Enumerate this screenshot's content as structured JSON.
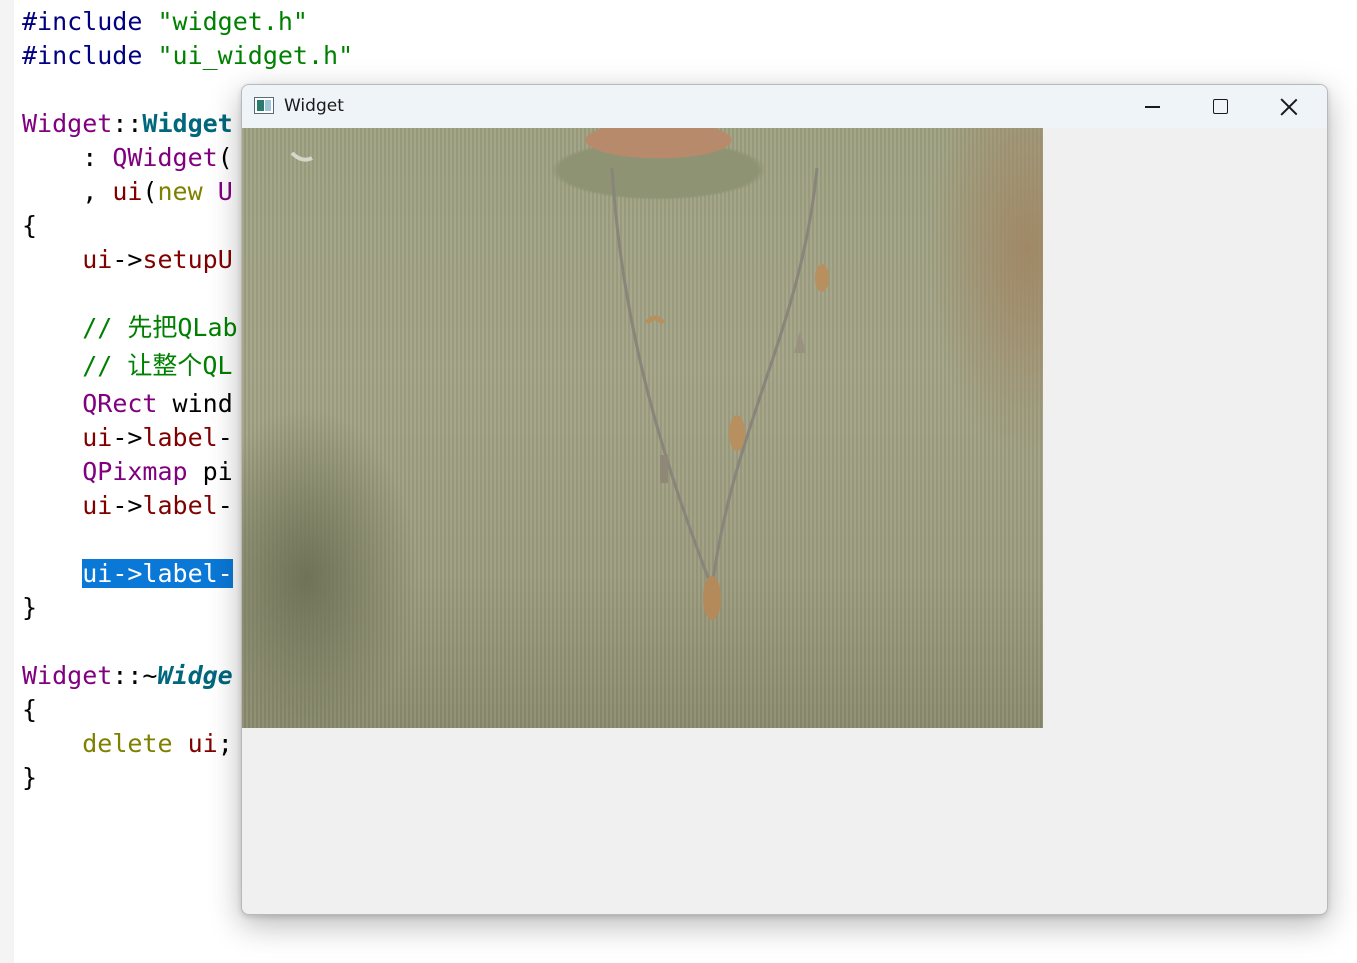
{
  "editor": {
    "lines": [
      {
        "segments": [
          {
            "t": "#include ",
            "c": "k-directive"
          },
          {
            "t": "\"widget.h\"",
            "c": "k-string"
          }
        ]
      },
      {
        "segments": [
          {
            "t": "#include ",
            "c": "k-directive"
          },
          {
            "t": "\"ui_widget.h\"",
            "c": "k-string"
          }
        ]
      },
      {
        "segments": [
          {
            "t": "Widget",
            "c": "k-class"
          },
          {
            "t": "::",
            "c": "k-plain"
          },
          {
            "t": "Widget",
            "c": "k-func-bold"
          }
        ]
      },
      {
        "segments": [
          {
            "t": "    : ",
            "c": "k-plain"
          },
          {
            "t": "QWidget",
            "c": "k-class"
          },
          {
            "t": "(",
            "c": "k-plain"
          }
        ]
      },
      {
        "segments": [
          {
            "t": "    , ",
            "c": "k-plain"
          },
          {
            "t": "ui",
            "c": "k-member"
          },
          {
            "t": "(",
            "c": "k-plain"
          },
          {
            "t": "new",
            "c": "k-keyword"
          },
          {
            "t": " U",
            "c": "k-class"
          }
        ]
      },
      {
        "segments": [
          {
            "t": "{",
            "c": "k-plain"
          }
        ]
      },
      {
        "segments": [
          {
            "t": "    ",
            "c": "k-plain"
          },
          {
            "t": "ui",
            "c": "k-member"
          },
          {
            "t": "->",
            "c": "k-plain"
          },
          {
            "t": "setupU",
            "c": "k-member"
          }
        ]
      },
      {
        "segments": [
          {
            "t": "    // 先把QLab",
            "c": "k-comment"
          }
        ]
      },
      {
        "segments": [
          {
            "t": "    // 让整个QL",
            "c": "k-comment"
          }
        ]
      },
      {
        "segments": [
          {
            "t": "    ",
            "c": "k-plain"
          },
          {
            "t": "QRect",
            "c": "k-class"
          },
          {
            "t": " wind",
            "c": "k-plain"
          }
        ]
      },
      {
        "segments": [
          {
            "t": "    ",
            "c": "k-plain"
          },
          {
            "t": "ui",
            "c": "k-member"
          },
          {
            "t": "->",
            "c": "k-plain"
          },
          {
            "t": "label",
            "c": "k-member"
          },
          {
            "t": "-",
            "c": "k-plain"
          }
        ]
      },
      {
        "segments": [
          {
            "t": "    ",
            "c": "k-plain"
          },
          {
            "t": "QPixmap",
            "c": "k-class"
          },
          {
            "t": " pi",
            "c": "k-plain"
          }
        ]
      },
      {
        "segments": [
          {
            "t": "    ",
            "c": "k-plain"
          },
          {
            "t": "ui",
            "c": "k-member"
          },
          {
            "t": "->",
            "c": "k-plain"
          },
          {
            "t": "label",
            "c": "k-member"
          },
          {
            "t": "-",
            "c": "k-plain"
          }
        ]
      },
      {
        "segments": [
          {
            "t": "    ",
            "c": "k-plain"
          },
          {
            "t": "ui->label-",
            "c": "sel"
          }
        ]
      },
      {
        "segments": [
          {
            "t": "}",
            "c": "k-plain"
          }
        ]
      },
      {
        "segments": [
          {
            "t": "Widget",
            "c": "k-class"
          },
          {
            "t": "::~",
            "c": "k-plain"
          },
          {
            "t": "Widge",
            "c": "k-func-ital"
          }
        ]
      },
      {
        "segments": [
          {
            "t": "{",
            "c": "k-plain"
          }
        ]
      },
      {
        "segments": [
          {
            "t": "    ",
            "c": "k-plain"
          },
          {
            "t": "delete",
            "c": "k-keyword"
          },
          {
            "t": " ",
            "c": "k-plain"
          },
          {
            "t": "ui",
            "c": "k-member"
          },
          {
            "t": ";",
            "c": "k-plain"
          }
        ]
      },
      {
        "segments": [
          {
            "t": "}",
            "c": "k-plain"
          }
        ]
      }
    ]
  },
  "window": {
    "title": "Widget",
    "app_icon": "qt-app-icon",
    "buttons": {
      "minimize": "minimize-icon",
      "maximize": "maximize-icon",
      "close": "close-icon"
    },
    "label_image": "photo of a person wearing a green knit sweater with a charm necklace"
  }
}
